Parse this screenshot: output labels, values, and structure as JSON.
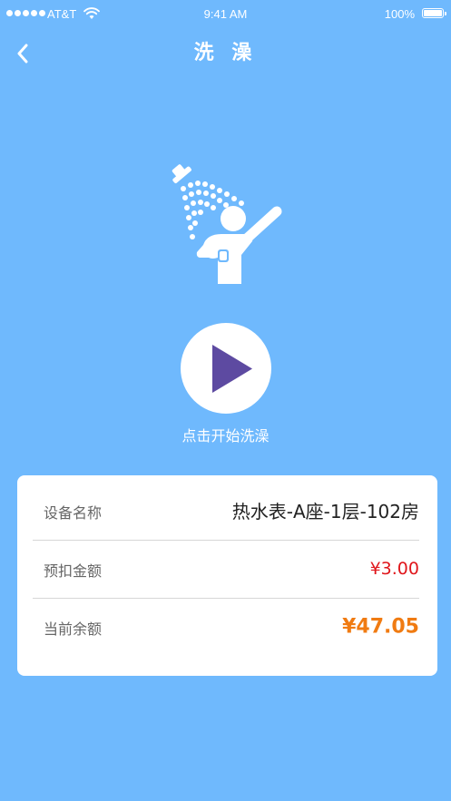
{
  "status_bar": {
    "carrier": "AT&T",
    "time": "9:41 AM",
    "battery": "100%"
  },
  "nav": {
    "back_icon": "chevron-left-icon",
    "title": "洗 澡"
  },
  "hero": {
    "shower_icon": "shower-person-icon",
    "play_icon": "play-icon",
    "start_label": "点击开始洗澡"
  },
  "details": {
    "device": {
      "label": "设备名称",
      "value": "热水表-A座-1层-102房"
    },
    "deduct": {
      "label": "预扣金额",
      "value": "¥3.00"
    },
    "balance": {
      "label": "当前余额",
      "value": "¥47.05"
    }
  },
  "colors": {
    "background": "#6fb9fd",
    "play_triangle": "#5d4aa1",
    "deduct": "#e0161b",
    "balance": "#f07b12"
  }
}
